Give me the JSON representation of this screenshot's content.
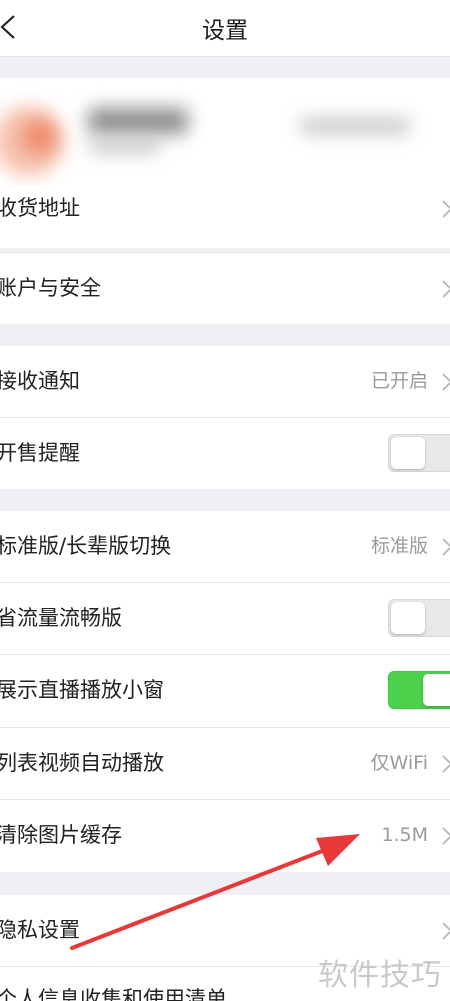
{
  "nav": {
    "title": "设置"
  },
  "rows": {
    "address": {
      "label": "收货地址"
    },
    "account": {
      "label": "账户与安全"
    },
    "notify": {
      "label": "接收通知",
      "value": "已开启"
    },
    "sale": {
      "label": "开售提醒",
      "toggle": "off"
    },
    "version": {
      "label": "标准版/长辈版切换",
      "value": "标准版"
    },
    "flow": {
      "label": "省流量流畅版",
      "toggle": "off"
    },
    "live": {
      "label": "展示直播播放小窗",
      "toggle": "on"
    },
    "autoplay": {
      "label": "列表视频自动播放",
      "value": "仅WiFi"
    },
    "cache": {
      "label": "清除图片缓存",
      "value": "1.5M"
    },
    "privacy": {
      "label": "隐私设置"
    },
    "personal": {
      "label": "个人信息收集和使用清单"
    }
  },
  "watermark": "软件技巧",
  "colors": {
    "toggle_on": "#4cd14c",
    "annotation_arrow": "#e8383a",
    "page_bg": "#efeff4"
  }
}
